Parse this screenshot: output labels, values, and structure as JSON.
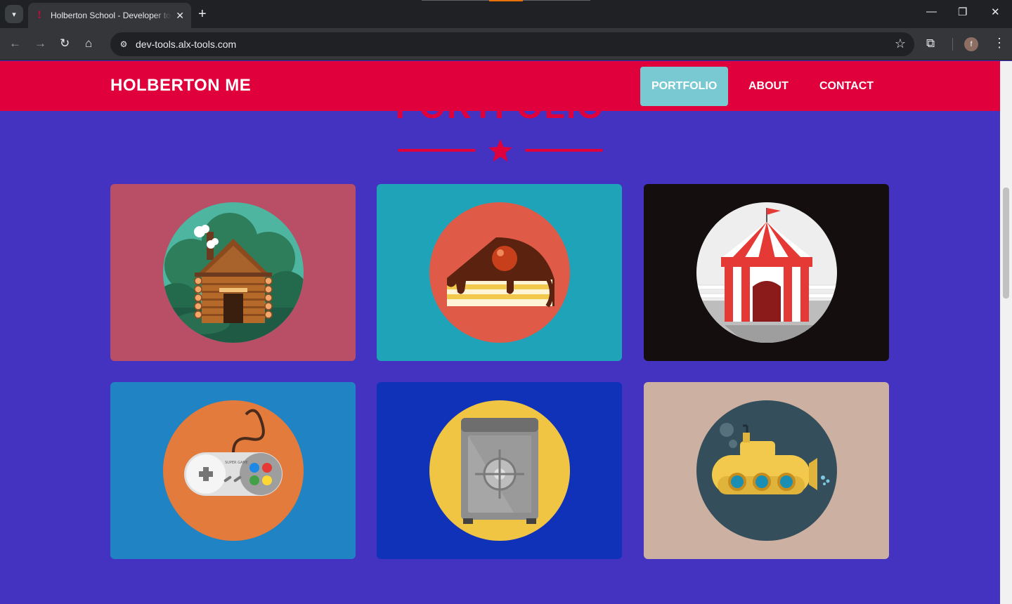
{
  "browser": {
    "tab_title": "Holberton School - Developer tools",
    "tab_close": "✕",
    "new_tab": "+",
    "url": "dev-tools.alx-tools.com",
    "profile_initial": "f",
    "window_controls": [
      "minimize-icon",
      "restore-icon",
      "close-icon"
    ]
  },
  "site": {
    "logo": "HOLBERTON ME",
    "nav": [
      {
        "label": "PORTFOLIO",
        "active": true
      },
      {
        "label": "ABOUT",
        "active": false
      },
      {
        "label": "CONTACT",
        "active": false
      }
    ],
    "section_title": "PORTFOLIO"
  },
  "portfolio": [
    {
      "icon": "cabin-icon",
      "bg": "#b84f67"
    },
    {
      "icon": "cake-icon",
      "bg": "#1fa3b8"
    },
    {
      "icon": "circus-tent-icon",
      "bg": "#140f0e"
    },
    {
      "icon": "game-controller-icon",
      "bg": "#1f83c4"
    },
    {
      "icon": "safe-icon",
      "bg": "#0f32b8"
    },
    {
      "icon": "submarine-icon",
      "bg": "#ccb1a2"
    }
  ],
  "controller_text": "SUPER GAME",
  "colors": {
    "brand_red": "#e0003b",
    "page_bg": "#4432c0",
    "nav_active": "#79c9d2"
  }
}
